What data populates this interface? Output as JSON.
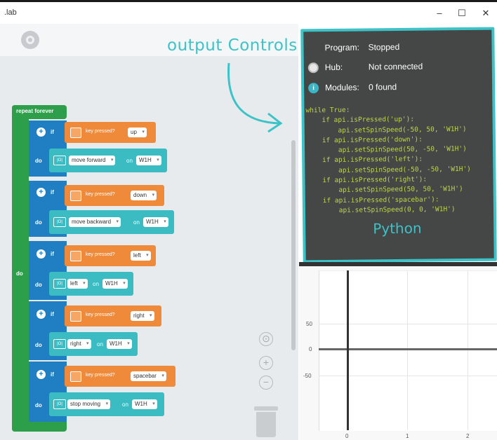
{
  "window": {
    "title": ".lab",
    "minimize": "–",
    "maximize": "☐",
    "close": "✕"
  },
  "annotation": {
    "output_controls": "output Controls",
    "python_label": "Python"
  },
  "blocks": {
    "loop_label": "repeat forever",
    "do_label": "do",
    "if_label": "if",
    "condition_text": "key pressed?",
    "rows": [
      {
        "key": "up",
        "action": "move forward",
        "on": "on",
        "motor": "W1H"
      },
      {
        "key": "down",
        "action": "move backward",
        "on": "on",
        "motor": "W1H"
      },
      {
        "key": "left",
        "action": "left",
        "on": "on",
        "motor": "W1H"
      },
      {
        "key": "right",
        "action": "right",
        "on": "on",
        "motor": "W1H"
      },
      {
        "key": "spacebar",
        "action": "stop moving",
        "on": "on",
        "motor": "W1H"
      }
    ],
    "zoom_center": "⊙",
    "zoom_in": "+",
    "zoom_out": "−"
  },
  "panel": {
    "program_label": "Program:",
    "program_value": "Stopped",
    "hub_label": "Hub:",
    "hub_value": "Not connected",
    "modules_label": "Modules:",
    "modules_value": "0 found",
    "modules_icon": "i",
    "code": "while True:\n    if api.isPressed('up'):\n        api.setSpinSpeed(-50, 50, 'W1H')\n    if api.isPressed('down'):\n        api.setSpinSpeed(50, -50, 'W1H')\n    if api.isPressed('left'):\n        api.setSpinSpeed(-50, -50, 'W1H')\n    if api.isPressed('right'):\n        api.setSpinSpeed(50, 50, 'W1H')\n    if api.isPressed('spacebar'):\n        api.setSpinSpeed(0, 0, 'W1H')"
  },
  "graph": {
    "y_ticks": [
      "50",
      "0",
      "-50"
    ],
    "x_ticks": [
      "0",
      "1",
      "2"
    ]
  }
}
